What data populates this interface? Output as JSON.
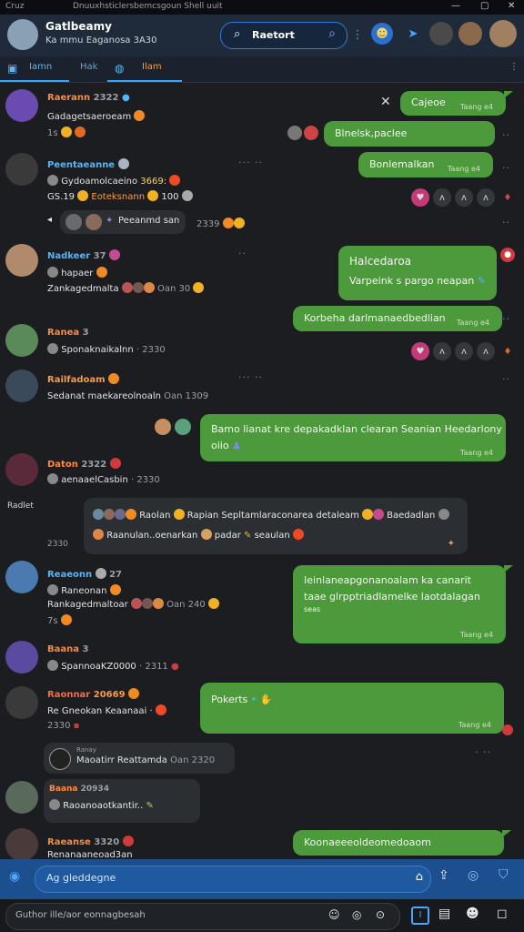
{
  "window": {
    "title": "Cruz",
    "url_text": "Dnuuxhsticlersbemcsgoun Shell uuit"
  },
  "header": {
    "title": "Gatlbeamy",
    "subtitle": "Ka mmu Eaganosa 3A30",
    "search_label": "Raetort",
    "colors": {
      "accent": "#2f7bd6",
      "bg": "#1f2a3a"
    }
  },
  "tabs": [
    {
      "label": "Iamn"
    },
    {
      "label": "Hak"
    },
    {
      "label": "Ilam"
    }
  ],
  "messages": {
    "m1": {
      "name": "Raerann",
      "time": "2322",
      "line1": "Gadagetsaeroeam",
      "line2": "1s"
    },
    "m1_out": {
      "text": "Cajeoe",
      "time": "Taang e4"
    },
    "m2_out": {
      "text": "Blnelsk,paclee"
    },
    "m3": {
      "name": "Peentaeanne",
      "line1": "Gydoamolcaeino",
      "line1b": "3669:",
      "line2": "GS.19",
      "line2b": "Eoteksnann",
      "line2c": "100"
    },
    "m3_out": {
      "text": "Bonlemalkan",
      "time": "Taang e4"
    },
    "m3_reply": {
      "text": "Peeanmd san",
      "time": "2339"
    },
    "m4": {
      "name": "Nadkeer",
      "time": "37",
      "line1": "hapaer",
      "line2": "Zankagedmalta",
      "line2b": "Oan 30"
    },
    "m4_out": {
      "title": "Halcedaroa",
      "text": "Varpeink s pargo neapan"
    },
    "m5_out": {
      "text": "Korbeha darlmanaedbedlian",
      "time": "Taang e4"
    },
    "m5": {
      "name": "Ranea",
      "time": "3",
      "line1": "Sponaknaikalnn",
      "line1b": "2330"
    },
    "m6": {
      "name": "Railfadoam",
      "line1": "Sedanat  maekareolnoaln",
      "line1b": "Oan 1309"
    },
    "m6_out": {
      "text": "Bamo lianat kre depakadklan clearan Seanian Heedarlony",
      "text2": "oiio",
      "time": "Taang e4"
    },
    "m7": {
      "name": "Daton",
      "time": "2322",
      "line1": "aenaaelCasbin",
      "line1b": "2330"
    },
    "m7_card": {
      "label": "Raolan",
      "line1": "Rapian Sepltamlaraconarea detaleam",
      "line1b": "Baedadlan",
      "line2": "Raanulan..oenarkan",
      "line2b": "padar",
      "line2c": "seaulan",
      "left": "Raonn",
      "time": "2330"
    },
    "m8": {
      "name": "Reaeonn",
      "time": "27",
      "line1": "Raneonan",
      "line2": "Rankagedmaltoar",
      "line2b": "Oan 240",
      "line3": "7s"
    },
    "m8_out": {
      "line1": "Ieinlaneapgonanoalam ka canarit",
      "line2": "taae glrpptriadlamelke laotdalagan",
      "line3": "seas",
      "time": "Taang e4"
    },
    "m9": {
      "name": "Baana",
      "time": "3",
      "line1": "SpannoaKZ0000",
      "line1b": "2311"
    },
    "m10": {
      "name": "Raonnar",
      "time": "20669",
      "line1": "Re Gneokan Keaanaai",
      "line2": "2330"
    },
    "m10_out": {
      "text": "Pokerts",
      "time": "Taang e4"
    },
    "m10_reply": {
      "label": "Ranay",
      "text": "Maoatirr Reattamda",
      "time": "Oan 2320"
    },
    "m11": {
      "name": "Baana",
      "time": "20934",
      "line1": "Raoanoaotkantir.."
    },
    "m12": {
      "name": "Raeanse",
      "time": "3320",
      "line1": "Renanaaneoad3an"
    },
    "m12_out": {
      "text": "Koonaeeeoldeomedoaom",
      "time": "Taang e4"
    },
    "left_label": "Radlet"
  },
  "compose": {
    "placeholder": "Ag gleddegne"
  },
  "bottom": {
    "placeholder": "Guthor ille/aor eonnagbesah"
  },
  "colors": {
    "bubble": "#4c9a3c",
    "bg": "#1b1d21",
    "name_orange": "#ff8a3d",
    "name_blue": "#4fb7ff"
  }
}
